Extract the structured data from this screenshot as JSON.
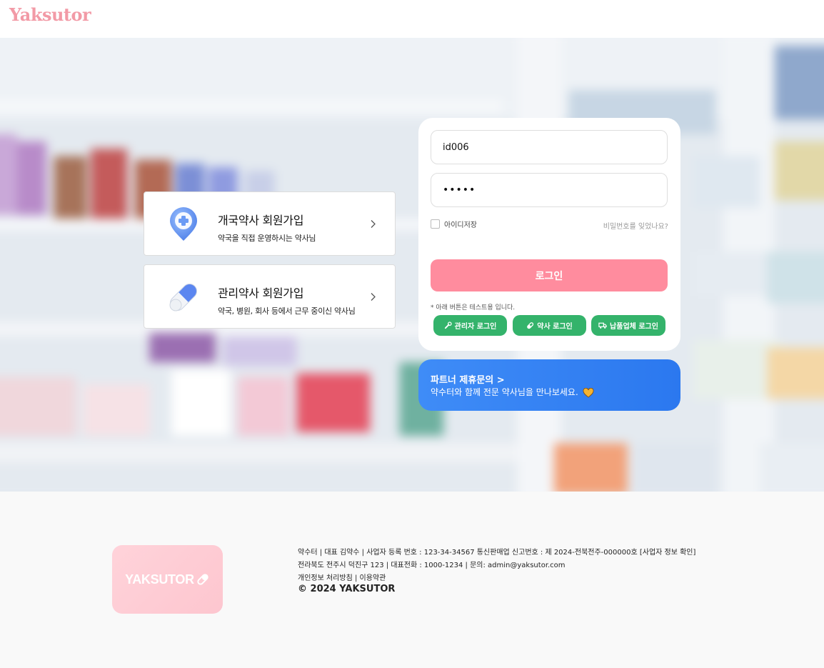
{
  "header": {
    "logo_text": "Yaksutor"
  },
  "signup_cards": [
    {
      "title": "개국약사 회원가입",
      "subtitle": "약국을 직접 운영하시는 약사님",
      "icon": "pharmacy-pin-icon"
    },
    {
      "title": "관리약사 회원가입",
      "subtitle": "약국, 병원, 회사 등에서 근무 중이신 약사님",
      "icon": "capsule-icon"
    }
  ],
  "login": {
    "id_value": "id006",
    "password_value": "•••••",
    "remember_label": "아이디저장",
    "forgot_label": "비밀번호를 잊었나요?",
    "login_label": "로그인",
    "test_note": "* 아래 버튼은 테스트용 입니다.",
    "test_buttons": [
      {
        "label": "관리자 로그인",
        "icon": "wrench-icon"
      },
      {
        "label": "약사 로그인",
        "icon": "pill-icon"
      },
      {
        "label": "납품업체 로그인",
        "icon": "truck-icon"
      }
    ]
  },
  "partner": {
    "title": "파트너 제휴문의 >",
    "subtitle": "약수터와 함께 전문 약사님을 만나보세요."
  },
  "footer": {
    "logo_text": "YAKSUTOR",
    "line1": "약수터 | 대표 김약수 | 사업자 등록 번호 : 123-34-34567 통신판매업 신고번호 : 제 2024-전북전주-000000호 [사업자 정보 확인]",
    "line2": "전라북도 전주시 덕진구 123 | 대표전화 : 1000-1234 | 문의: admin@yaksutor.com",
    "line3": "개인정보 처리방침 | 이용약관",
    "copyright": "© 2024 YAKSUTOR"
  },
  "colors": {
    "brand_pink": "#ff8c9e",
    "test_green": "#34b36b",
    "partner_blue": "#3f8cf7"
  }
}
